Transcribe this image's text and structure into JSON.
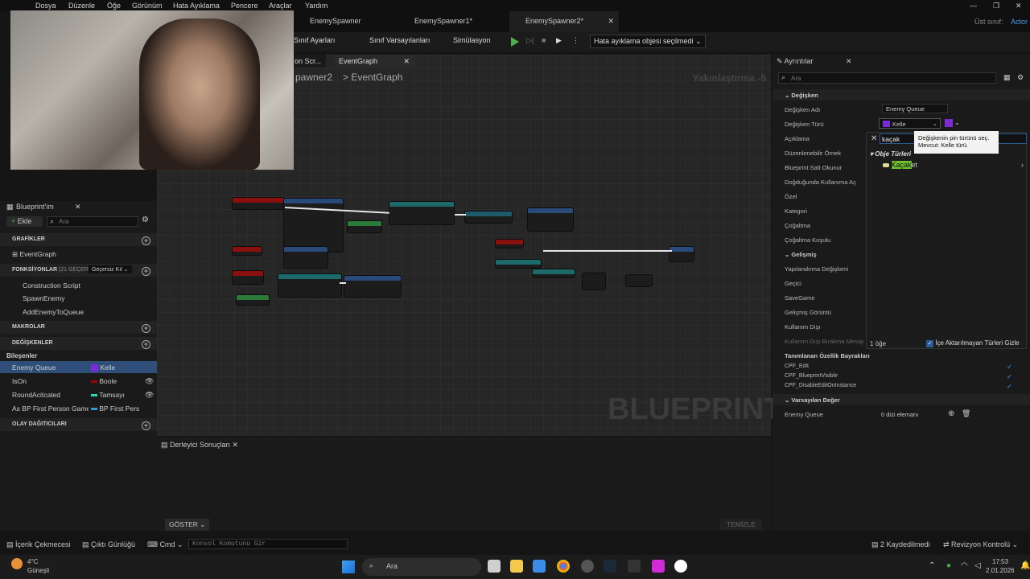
{
  "menu": [
    "Dosya",
    "Düzenle",
    "Öğe",
    "Görünüm",
    "Hata Ayıklama",
    "Pencere",
    "Araçlar",
    "Yardım"
  ],
  "tabs": [
    "EnemySpawner",
    "EnemySpawner1*",
    "EnemySpawner2*"
  ],
  "parent_class": {
    "label": "Üst sınıf:",
    "value": "Actor"
  },
  "toolbar": {
    "class_settings": "Sınıf Ayarları",
    "class_defaults": "Sınıf Varsayılanları",
    "simulation": "Simülasyon",
    "debug_object": "Hata ayıklama objesi seçilmedi"
  },
  "graph": {
    "tab_construction": "on Scr...",
    "tab_eventgraph": "EventGraph",
    "breadcrumb_prev": "pawner2",
    "breadcrumb": "EventGraph",
    "zoom": "Yakınlaştırma -5",
    "watermark": "BLUEPRINT"
  },
  "compiler": {
    "title": "Derleyici Sonuçları",
    "show": "GÖSTER",
    "clear": "TEMİZLE"
  },
  "myblueprint": {
    "title": "Blueprint'im",
    "add": "Ekle",
    "search_placeholder": "Ara",
    "graphs": "GRAFİKLER",
    "eventgraph": "EventGraph",
    "functions": "FONKSİYONLAR",
    "functions_count": "(21 GEÇERSİ",
    "override": "Geçersiz Kıl",
    "function_items": [
      "Construction Script",
      "SpawnEnemy",
      "AddEnemyToQueue"
    ],
    "macros": "MAKROLAR",
    "variables": "DEĞİŞKENLER",
    "components": "Bileşenler",
    "var_items": [
      {
        "name": "Enemy Queue",
        "type": "Kelle",
        "color": "#7a2bd6"
      },
      {
        "name": "IsOn",
        "type": "Boole",
        "color": "#a00000"
      },
      {
        "name": "RoundAcitcated",
        "type": "Tamsayı",
        "color": "#2ed6b8"
      },
      {
        "name": "As BP First Person Game",
        "type": "BP First Pers",
        "color": "#2a9bd6"
      }
    ],
    "dispatchers": "OLAY DAĞITICILARI"
  },
  "details": {
    "title": "Ayrıntılar",
    "search_placeholder": "Ara",
    "variable": "Değişken",
    "var_name_label": "Değişken Adı",
    "var_name": "Enemy Queue",
    "var_type_label": "Değişken Türü",
    "var_type": "Kelle",
    "rows": [
      "Açıklama",
      "Düzenlenebilir Örnek",
      "Blueprint Salt Okunur",
      "Doğduğunda Kullanıma Aç",
      "Özel",
      "Kategori",
      "Çoğaltma",
      "Çoğaltma Koşulu"
    ],
    "advanced": "Gelişmiş",
    "adv_rows": [
      "Yapılandırma Değişkeni",
      "Geçici",
      "SaveGame",
      "Gelişmiş Görüntü",
      "Kullanım Dışı",
      "Kullanım Dışı Bırakma Mesajı"
    ],
    "flags_title": "Tanımlanan Özellik Bayrakları",
    "flags": [
      "CPF_Edit",
      "CPF_BlueprintVisible",
      "CPF_DisableEditOnInstance"
    ],
    "defaults": "Varsayılan Değer",
    "default_label": "Enemy Queue",
    "default_value": "0 dizi elemanı"
  },
  "popup": {
    "search": "kaçak",
    "category": "Obje Türleri",
    "result_highlight": "Kaçak",
    "result_rest": "et",
    "count": "1 öğe",
    "hide_label": "İçe Aktarılmayan Türleri Gizle"
  },
  "tooltip": {
    "line1": "Değişkenin pin türünü seç.",
    "line2": "Mevcut: Kelle türü."
  },
  "bottom": {
    "drawer": "İçerik Çekmecesi",
    "log": "Çıktı Günlüğü",
    "cmd": "Cmd",
    "console_placeholder": "Konsol Komutunu Gir",
    "saved": "2 Kaydedilmedi",
    "revision": "Revizyon Kontrolü"
  },
  "taskbar": {
    "temp": "4°C",
    "weather": "Güneşli",
    "search": "Ara",
    "time": "17:53",
    "date": "2.01.2026"
  }
}
